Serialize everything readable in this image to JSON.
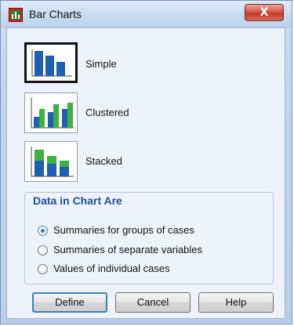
{
  "window": {
    "title": "Bar Charts",
    "close_glyph": "X",
    "icon": "bar-chart-app-icon"
  },
  "chart_types": [
    {
      "label": "Simple",
      "icon": "simple-bar-icon",
      "selected": true
    },
    {
      "label": "Clustered",
      "icon": "clustered-bar-icon",
      "selected": false
    },
    {
      "label": "Stacked",
      "icon": "stacked-bar-icon",
      "selected": false
    }
  ],
  "data_group": {
    "legend": "Data in Chart Are",
    "options": [
      {
        "label": "Summaries for groups of cases",
        "checked": true
      },
      {
        "label": "Summaries of separate variables",
        "checked": false
      },
      {
        "label": "Values of individual cases",
        "checked": false
      }
    ]
  },
  "buttons": {
    "define": "Define",
    "cancel": "Cancel",
    "help": "Help"
  },
  "colors": {
    "bar_blue": "#1f5fb0",
    "bar_green": "#3cb043",
    "legend_text": "#1c4f9a",
    "radio_dot": "#2a7fd4"
  }
}
